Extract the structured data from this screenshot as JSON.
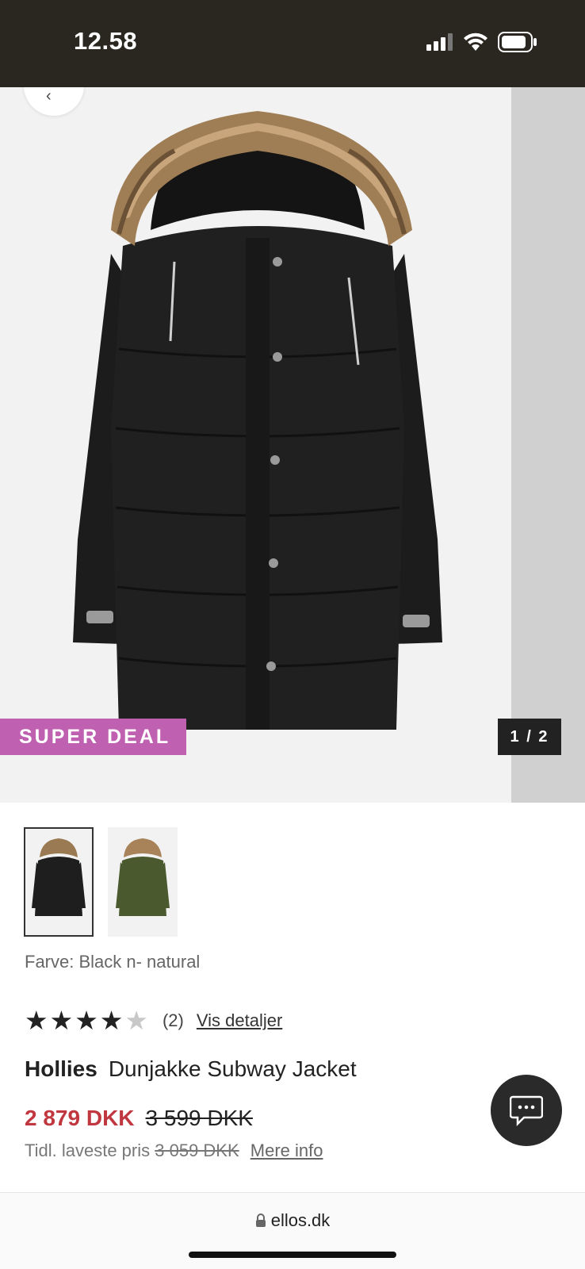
{
  "status_bar": {
    "time": "12.58"
  },
  "gallery": {
    "badge": "SUPER DEAL",
    "counter": "1 / 2"
  },
  "colors": {
    "badge": "#c060b0",
    "price": "#c0373f",
    "dark": "#2a2720"
  },
  "thumbnails": [
    {
      "color_name": "black",
      "selected": true
    },
    {
      "color_name": "green",
      "selected": false
    }
  ],
  "product": {
    "color_label": "Farve: Black n- natural",
    "rating_value": 4,
    "rating_max": 5,
    "review_count": "(2)",
    "details_link": "Vis detaljer",
    "brand": "Hollies",
    "name": "Dunjakke Subway Jacket",
    "price_now": "2 879 DKK",
    "price_old": "3 599 DKK",
    "lowest_label": "Tidl. laveste pris",
    "lowest_price": "3 059 DKK",
    "more_info": "Mere info"
  },
  "browser": {
    "url": "ellos.dk"
  },
  "icons": [
    "signal-icon",
    "wifi-icon",
    "battery-icon",
    "back-arrow-icon",
    "star-icon",
    "chat-icon",
    "lock-icon"
  ]
}
